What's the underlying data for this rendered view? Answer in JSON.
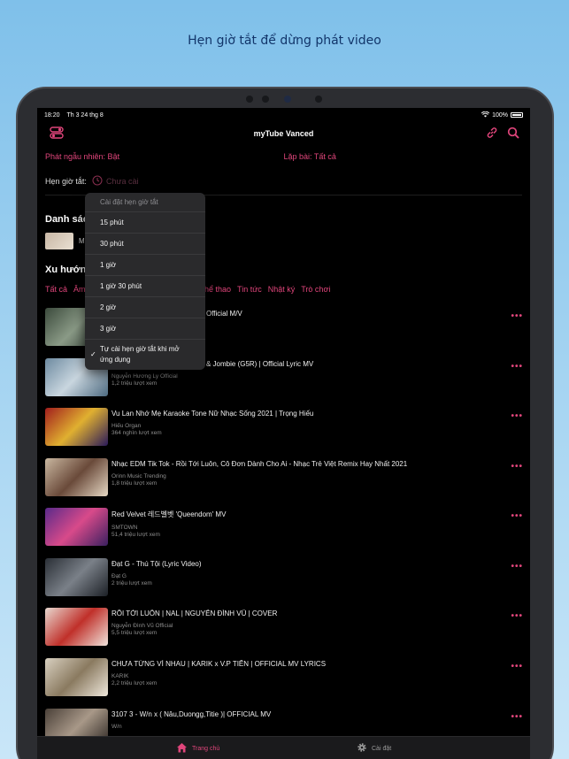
{
  "headline": "Hẹn giờ tắt để dừng phát video",
  "status_bar": {
    "time": "18:20",
    "date": "Th 3 24 thg 8",
    "battery": "100%"
  },
  "app": {
    "title": "myTube Vanced",
    "shuffle": "Phát ngẫu nhiên: Bật",
    "repeat": "Lặp bài: Tất cả",
    "sleep_timer_label": "Hẹn giờ tắt:",
    "sleep_timer_value": "Chưa cài",
    "playlists_title": "Danh sách",
    "playlist_item": "M",
    "trending_title": "Xu hướng",
    "categories": [
      "Tất cả",
      "Âm",
      "Thể thao",
      "Tin tức",
      "Nhật ký",
      "Trò chơi"
    ]
  },
  "dropdown": {
    "header": "Cài đặt hẹn giờ tắt",
    "options": [
      "15 phút",
      "30 phút",
      "1 giờ",
      "1 giờ 30 phút",
      "2 giờ",
      "3 giờ"
    ],
    "custom_line1": "Tự cài hẹn giờ tắt khi mở",
    "custom_line2": "ứng dụng",
    "checkmark": "✓"
  },
  "videos": [
    {
      "title": "Official M/V",
      "channel": "",
      "views": ""
    },
    {
      "title": "& Jombie (G5R) | Official Lyric MV",
      "channel": "Nguyễn Hương Ly Official",
      "views": "1,2 triệu lượt xem"
    },
    {
      "title": "Vu Lan Nhớ Mẹ Karaoke Tone Nữ Nhạc Sống 2021 | Trọng Hiếu",
      "channel": "Hiếu Organ",
      "views": "364 nghìn lượt xem"
    },
    {
      "title": "Nhạc EDM Tik Tok - Rồi Tới Luôn, Cô Đơn Dành Cho Ai - Nhạc Trẻ Việt Remix Hay Nhất 2021",
      "channel": "Orinn Music Trending",
      "views": "1,8 triệu lượt xem"
    },
    {
      "title": "Red Velvet 레드벨벳 'Queendom' MV",
      "channel": "SMTOWN",
      "views": "51,4 triệu lượt xem"
    },
    {
      "title": "Đạt G - Thú Tội (Lyric Video)",
      "channel": "Đạt G",
      "views": "2 triệu lượt xem"
    },
    {
      "title": "RỒI TỚI LUÔN | NAL | NGUYỄN ĐÌNH VŨ | COVER",
      "channel": "Nguyễn Đình Vũ Official",
      "views": "5,5 triệu lượt xem"
    },
    {
      "title": "CHƯA TỪNG VÌ NHAU | KARIK x V.P TIẾN | OFFICIAL MV LYRICS",
      "channel": "KARIK",
      "views": "2,2 triệu lượt xem"
    },
    {
      "title": "3107 3 - W/n  x ( Nâu,Duongg,Titie )| OFFICIAL MV",
      "channel": "W/n",
      "views": ""
    }
  ],
  "tabs": {
    "home": "Trang chủ",
    "settings": "Cài đặt"
  },
  "colors": {
    "accent": "#e0457b",
    "background": "#000000",
    "menu": "#2a2a2c"
  }
}
